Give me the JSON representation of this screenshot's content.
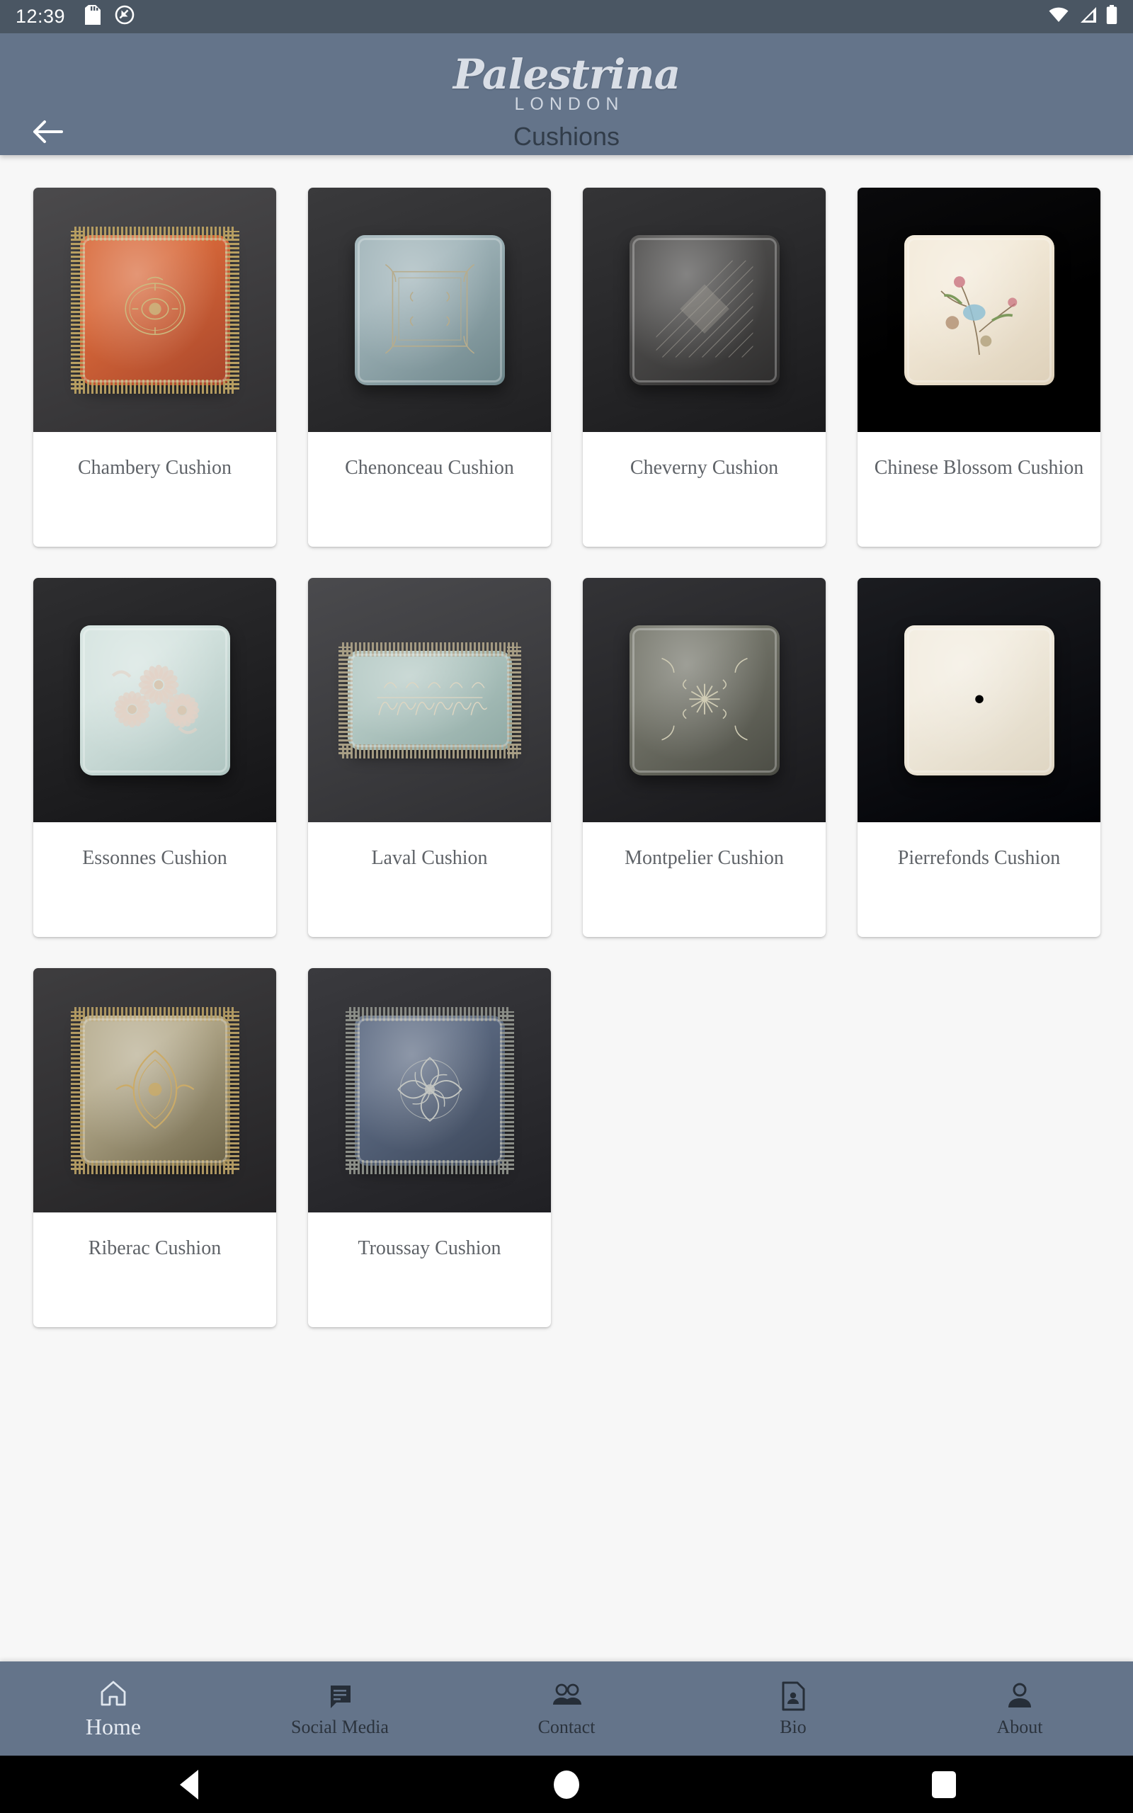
{
  "status_bar": {
    "time": "12:39",
    "left_icons": [
      "sd-card-icon",
      "do-not-disturb-icon"
    ],
    "right_icons": [
      "wifi-icon",
      "cellular-signal-icon",
      "battery-icon"
    ],
    "background_color": "#4a5663"
  },
  "app_bar": {
    "back_icon": "back-arrow-icon",
    "brand_name": "Palestrina",
    "brand_sub": "LONDON",
    "subtitle": "Cushions",
    "background_color": "#64748a",
    "subtitle_color": "#313c49"
  },
  "page": {
    "background_color": "#f7f7f7",
    "columns": 4
  },
  "products": [
    {
      "name": "Chambery Cushion",
      "wall": "#4b4a4c",
      "fabric_a": "#d8693a",
      "fabric_b": "#a8452a",
      "trim": "#b9a062",
      "motif": "medallion",
      "motif_color": "#cbb97f",
      "shape": "square",
      "fringe": true
    },
    {
      "name": "Chenonceau Cushion",
      "wall": "#3a3a3c",
      "fabric_a": "#9fb3b8",
      "fabric_b": "#6c8489",
      "trim": "#9b9179",
      "motif": "frame",
      "motif_color": "#b7ac8c",
      "shape": "square",
      "fringe": false
    },
    {
      "name": "Cheverny Cushion",
      "wall": "#343436",
      "fabric_a": "#4e4d4c",
      "fabric_b": "#2e2d2d",
      "trim": "#8e8b85",
      "motif": "diamond",
      "motif_color": "#a9a59c",
      "shape": "square",
      "fringe": false
    },
    {
      "name": "Chinese Blossom Cushion",
      "wall": "#0a0a0c",
      "fabric_a": "#f3ead9",
      "fabric_b": "#ddd0b9",
      "trim": "#e8dcc6",
      "motif": "blossom",
      "motif_color": "#8a9a6a",
      "shape": "square",
      "fringe": false
    },
    {
      "name": "Essonnes Cushion",
      "wall": "#2e2e30",
      "fabric_a": "#d4e3df",
      "fabric_b": "#aec4c0",
      "trim": "#c9c2ae",
      "motif": "starburst-trio",
      "motif_color": "#e3d2c6",
      "shape": "square",
      "fringe": false
    },
    {
      "name": "Laval Cushion",
      "wall": "#4a4a4d",
      "fabric_a": "#b4c9c4",
      "fabric_b": "#8fa9a4",
      "trim": "#a99f85",
      "motif": "scroll",
      "motif_color": "#ded6c2",
      "shape": "bolster",
      "fringe": true
    },
    {
      "name": "Montpelier Cushion",
      "wall": "#333336",
      "fabric_a": "#74756a",
      "fabric_b": "#4b4c44",
      "trim": "#9c9a86",
      "motif": "star-scroll",
      "motif_color": "#cfcbb4",
      "shape": "square",
      "fringe": false
    },
    {
      "name": "Pierrefonds Cushion",
      "wall": "#1b1c20",
      "fabric_a": "#f2ecdf",
      "fabric_b": "#ded5c2",
      "trim": "#c8ab63",
      "motif": "gold-star",
      "motif_color": "#c9a košk"
    },
    {
      "name": "Riberac Cushion",
      "wall": "#3e3d3f",
      "fabric_a": "#b5ab8d",
      "fabric_b": "#6d6448",
      "trim": "#b39b63",
      "motif": "ogee",
      "motif_color": "#cbab68",
      "shape": "square",
      "fringe": true
    },
    {
      "name": "Troussay Cushion",
      "wall": "#3a3a3e",
      "fabric_a": "#5c6a82",
      "fabric_b": "#3b4659",
      "trim": "#8c8f88",
      "motif": "rosette",
      "motif_color": "#c3c6c2",
      "shape": "square",
      "fringe": true
    }
  ],
  "bottom_nav": {
    "background_color": "#64748a",
    "items": [
      {
        "label": "Home",
        "icon": "home-icon",
        "active": true
      },
      {
        "label": "Social Media",
        "icon": "chat-bubble-icon",
        "active": false
      },
      {
        "label": "Contact",
        "icon": "people-icon",
        "active": false
      },
      {
        "label": "Bio",
        "icon": "document-person-icon",
        "active": false
      },
      {
        "label": "About",
        "icon": "person-icon",
        "active": false
      }
    ]
  },
  "system_nav": {
    "back": "back-triangle-icon",
    "home": "home-circle-icon",
    "recents": "recents-square-icon"
  }
}
